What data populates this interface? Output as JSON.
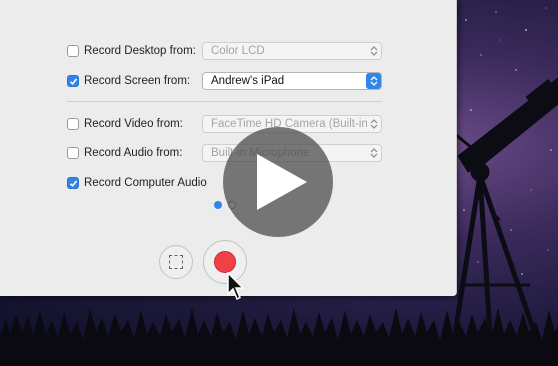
{
  "options": [
    {
      "label": "Record Desktop from:",
      "checked": false,
      "select_value": "Color LCD",
      "select_active": false
    },
    {
      "label": "Record Screen from:",
      "checked": true,
      "select_value": "Andrew's iPad",
      "select_active": true
    },
    {
      "label": "Record Video from:",
      "checked": false,
      "select_value": "FaceTime HD Camera (Built-in)",
      "select_active": false
    },
    {
      "label": "Record Audio from:",
      "checked": false,
      "select_value": "Built-in Microphone",
      "select_active": false
    },
    {
      "label": "Record Computer Audio",
      "checked": true
    }
  ],
  "pagination": {
    "current": 1,
    "total": 2
  },
  "buttons": {
    "region": "region-select",
    "record": "record"
  },
  "colors": {
    "accent": "#2f85e8",
    "record": "#f04246",
    "panel": "#ececec"
  },
  "icons": [
    "checkmark-icon",
    "select-arrows-icon",
    "region-select-icon",
    "record-icon",
    "mouse-cursor-icon",
    "play-icon",
    "telescope"
  ]
}
